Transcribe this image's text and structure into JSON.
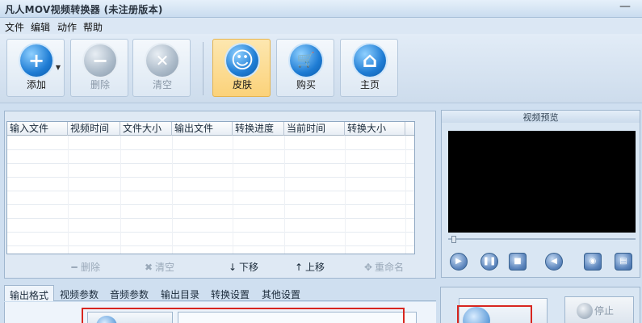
{
  "window": {
    "title": "凡人MOV视频转换器  (未注册版本)",
    "minimize_glyph": "—"
  },
  "menu": [
    "文件",
    "编辑",
    "动作",
    "帮助"
  ],
  "toolbar": {
    "add": {
      "label": "添加",
      "icon": "plus-icon",
      "glyph": "+"
    },
    "delete": {
      "label": "删除",
      "icon": "minus-icon",
      "glyph": "−"
    },
    "clear": {
      "label": "清空",
      "icon": "x-icon",
      "glyph": "✕"
    },
    "skin": {
      "label": "皮肤",
      "icon": "smiley-icon",
      "glyph": "☺"
    },
    "buy": {
      "label": "购买",
      "icon": "cart-icon",
      "glyph": "🛒"
    },
    "home": {
      "label": "主页",
      "icon": "home-icon",
      "glyph": "⌂"
    }
  },
  "file_list": {
    "columns": [
      "输入文件",
      "视频时间",
      "文件大小",
      "输出文件",
      "转换进度",
      "当前时间",
      "转换大小"
    ],
    "rows": []
  },
  "list_actions": {
    "delete": "删除",
    "clear": "清空",
    "down": "下移",
    "up": "上移",
    "rename": "重命名"
  },
  "preview": {
    "title": "视频预览"
  },
  "tabs": [
    "输出格式",
    "视频参数",
    "音频参数",
    "输出目录",
    "转换设置",
    "其他设置"
  ],
  "convert": {
    "stop_label": "停止"
  },
  "colors": {
    "highlight_box": "#d8261f",
    "active_button": "#fbd27a",
    "accent_blue": "#1e7cd4"
  }
}
